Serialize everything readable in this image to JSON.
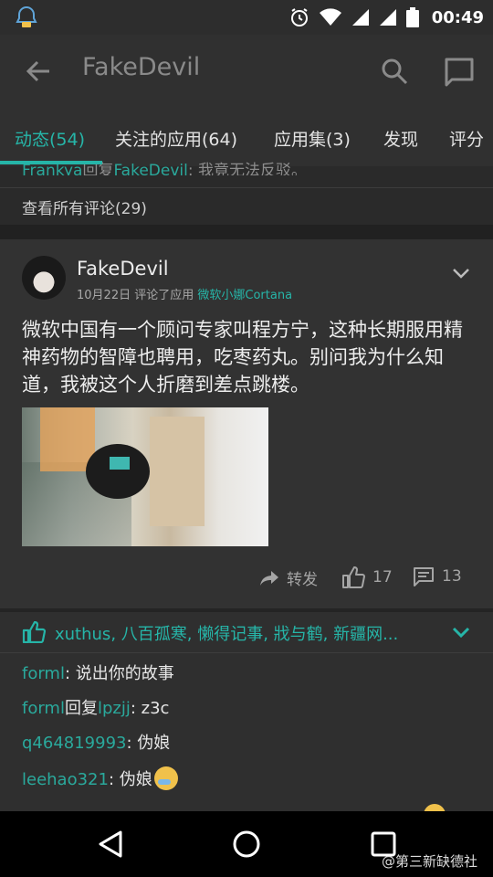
{
  "status_bar": {
    "time": "00:49"
  },
  "app_bar": {
    "title": "FakeDevil"
  },
  "tabs": [
    {
      "label": "动态(54)",
      "active": true
    },
    {
      "label": "关注的应用(64)",
      "active": false
    },
    {
      "label": "应用集(3)",
      "active": false
    },
    {
      "label": "发现",
      "active": false
    },
    {
      "label": "评分",
      "active": false
    }
  ],
  "previous_post": {
    "comment_user": "Frankya",
    "comment_reply_word": "回复",
    "comment_target": "FakeDevil",
    "comment_text": ": 我竟无法反驳。",
    "see_all": "查看所有评论(29)"
  },
  "post": {
    "author": "FakeDevil",
    "date": "10月22日",
    "action": "评论了应用",
    "app_name": "微软小娜Cortana",
    "text": "微软中国有一个顾问专家叫程方宁，这种长期服用精神药物的智障也聘用，吃枣药丸。别问我为什么知道，我被这个人折磨到差点跳楼。",
    "actions": {
      "share_label": "转发",
      "like_count": "17",
      "comment_count": "13"
    }
  },
  "likes_line": "xuthus, 八百孤寒, 懒得记事, 戕与鹤, 新疆网...",
  "comments": [
    {
      "user": "forml",
      "reply_word": "",
      "target": "",
      "text": ": 说出你的故事"
    },
    {
      "user": "forml",
      "reply_word": "回复",
      "target": "lpzjj",
      "text": ": z3c"
    },
    {
      "user": "q464819993",
      "reply_word": "",
      "target": "",
      "text": ": 伪娘"
    },
    {
      "user": "leehao321",
      "reply_word": "",
      "target": "",
      "text": ": 伪娘"
    }
  ],
  "watermark": "@第三新缺德社",
  "colors": {
    "accent": "#26b5a8",
    "background": "#2a2a2a",
    "card": "#323232"
  }
}
